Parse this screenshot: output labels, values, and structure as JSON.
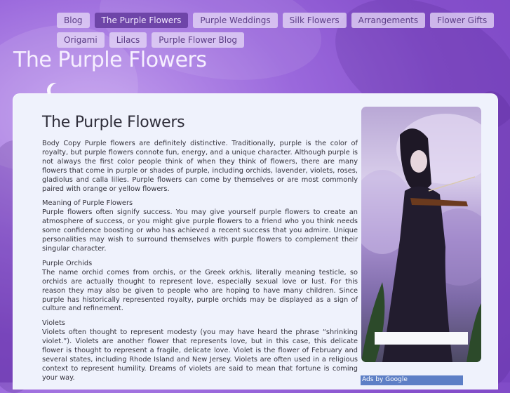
{
  "nav": {
    "row1": [
      "Blog",
      "The Purple Flowers",
      "Purple Weddings",
      "Silk Flowers",
      "Arrangements",
      "Flower Gifts"
    ],
    "row2": [
      "Origami",
      "Lilacs",
      "Purple Flower Blog"
    ],
    "active": "The Purple Flowers"
  },
  "site": {
    "title": "The Purple Flowers"
  },
  "main": {
    "title": "The Purple Flowers",
    "p1": "Body Copy      Purple flowers are definitely distinctive. Traditionally, purple is the color of royalty, but purple flowers connote fun, energy, and a unique character. Although purple is not always the first color people think of when they think of flowers, there are many flowers that come in purple or shades of purple, including orchids, lavender, violets, roses, gladiolus and calla lilies. Purple flowers can come by themselves or are most commonly paired with orange or yellow flowers.",
    "h2": "Meaning of Purple Flowers",
    "p2": "Purple flowers often signify success. You may give yourself purple flowers to create an atmosphere of success, or you might give purple flowers to a friend who you think needs some confidence boosting or who has achieved a recent success that you admire. Unique personalities may wish to surround themselves with purple flowers to complement their singular character.",
    "h3": "Purple Orchids",
    "p3": "The name orchid comes from orchis, or the Greek orkhis, literally meaning testicle, so orchids are actually thought to represent love, especially sexual love or lust. For this reason they may also be given to people who are hoping to have many children. Since purple has historically represented royalty, purple orchids may be displayed as a sign of culture and refinement.",
    "h4": "Violets",
    "p4": "Violets often thought to represent modesty (you may have heard the phrase “shrinking violet.”). Violets are another flower that represents love, but in this case, this delicate flower is thought to represent a fragile, delicate love. Violet is the flower of February and several states, including Rhode Island and New Jersey. Violets are often used in a religious context to represent humility. Dreams of violets are said to mean that fortune is coming your way."
  },
  "sidebar": {
    "image_icon": "violinist-image"
  },
  "ads": {
    "label": "Ads by Google"
  },
  "colors": {
    "active_tab": "#6e45a8",
    "tab_bg": "#e4d6f6",
    "content_bg": "#eff2fc",
    "ads_bg": "#5d7fc6"
  }
}
